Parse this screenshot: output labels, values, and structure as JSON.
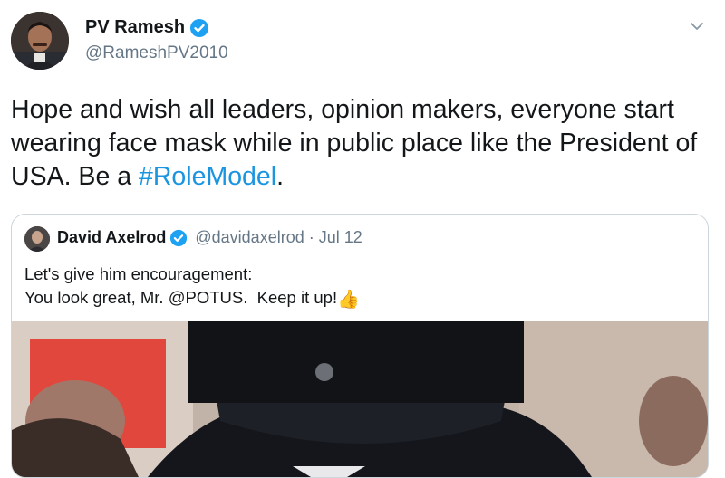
{
  "author": {
    "display_name": "PV Ramesh",
    "handle": "@RameshPV2010",
    "avatar_icon": "user-avatar-photo",
    "verified_icon": "verified-badge-icon",
    "menu_icon": "chevron-down-icon"
  },
  "tweet": {
    "text_main": "Hope and wish all leaders, opinion makers, everyone start wearing face mask while in public place like the President of USA. Be a ",
    "hashtag": "#RoleModel",
    "text_end": "."
  },
  "quoted_tweet": {
    "display_name": "David Axelrod",
    "handle": "@davidaxelrod",
    "separator": "·",
    "date": "Jul 12",
    "line1": "Let's give him encouragement:",
    "line2": "You look great, Mr. @POTUS.  Keep it up!",
    "emoji": "👍",
    "media_description_icon": "photo-image"
  },
  "colors": {
    "link": "#1b95e0",
    "secondary_text": "#657786",
    "border": "#ccd6dd",
    "verified": "#1da1f2"
  }
}
